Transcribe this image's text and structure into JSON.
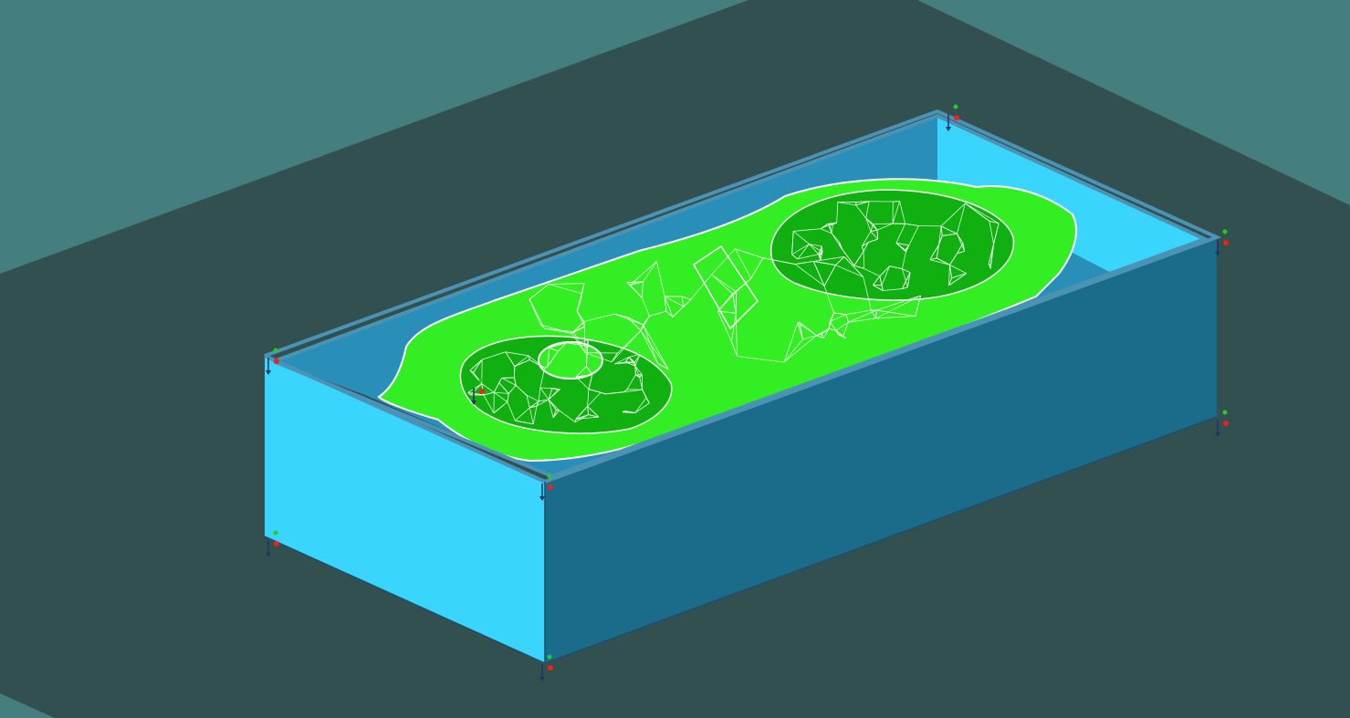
{
  "viewport": {
    "kind": "3d-viewport",
    "projection": "isometric"
  },
  "colors": {
    "background_light": "#447E7E",
    "background_dark": "#335050",
    "box_side_light": "#3AD5FC",
    "box_side_dark": "#1B6B8B",
    "box_rim": "#4A93B5",
    "box_inner_light": "#3AD5FC",
    "box_inner_floor": "#2A8FB8",
    "mesh_fill": "#33EE22",
    "mesh_fill_dark": "#10B010",
    "mesh_edge": "#FFFFFF",
    "axis_x": "#EE2020",
    "axis_y": "#22CC22",
    "axis_z": "#223366"
  },
  "scene": {
    "objects": [
      {
        "name": "mold-box",
        "type": "box",
        "style": "solid"
      },
      {
        "name": "part-mesh",
        "type": "triangle-mesh",
        "style": "wireframe-shaded"
      }
    ],
    "triads": [
      "corner-1",
      "corner-2",
      "corner-3",
      "corner-4",
      "corner-5",
      "corner-6",
      "corner-7",
      "corner-8"
    ]
  }
}
